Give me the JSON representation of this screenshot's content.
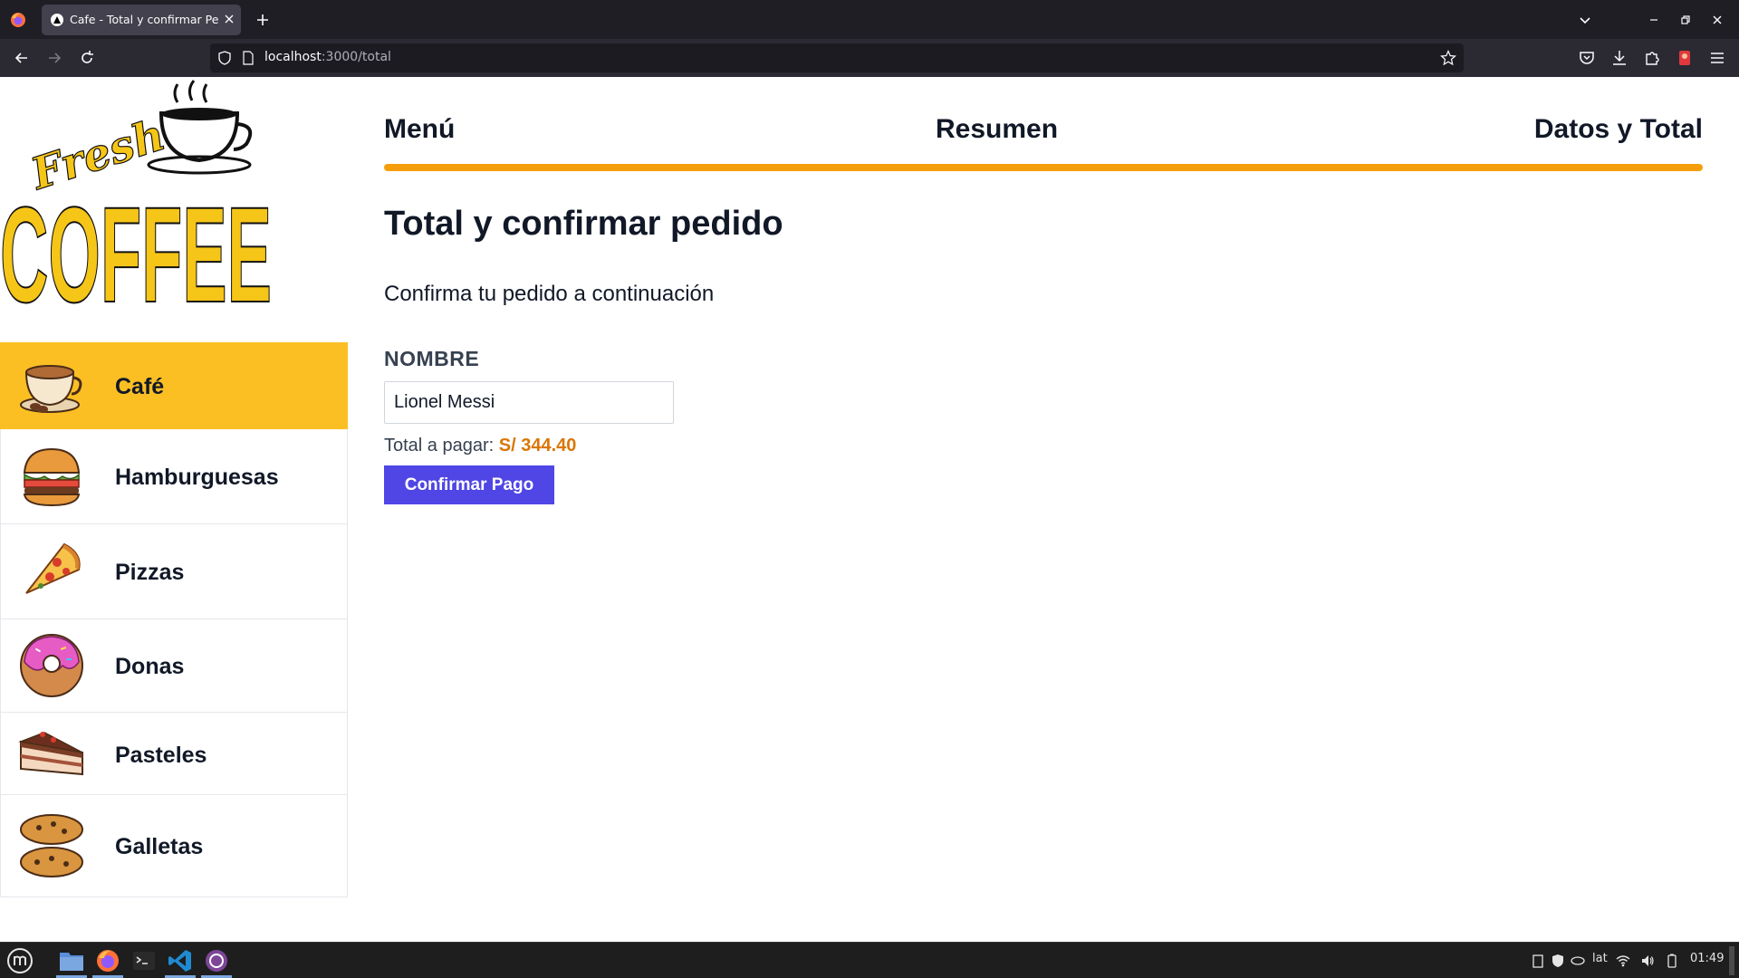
{
  "browser": {
    "tab_title": "Cafe - Total y confirmar Pedido",
    "url_host": "localhost",
    "url_path": ":3000/total"
  },
  "logo": {
    "script_word": "Fresh",
    "main_word": "COFFEE"
  },
  "sidebar": {
    "items": [
      {
        "label": "Café",
        "icon": "coffee-cup-icon",
        "active": true
      },
      {
        "label": "Hamburguesas",
        "icon": "burger-icon",
        "active": false
      },
      {
        "label": "Pizzas",
        "icon": "pizza-slice-icon",
        "active": false
      },
      {
        "label": "Donas",
        "icon": "donut-icon",
        "active": false
      },
      {
        "label": "Pasteles",
        "icon": "cake-slice-icon",
        "active": false
      },
      {
        "label": "Galletas",
        "icon": "cookies-icon",
        "active": false
      }
    ]
  },
  "steps": [
    {
      "label": "Menú"
    },
    {
      "label": "Resumen"
    },
    {
      "label": "Datos y Total"
    }
  ],
  "progress": 1.0,
  "main": {
    "title": "Total y confirmar pedido",
    "subtitle": "Confirma tu pedido a continuación",
    "name_label": "NOMBRE",
    "name_value": "Lionel Messi",
    "total_label": "Total a pagar:",
    "total_amount": "S/ 344.40",
    "confirm_button": "Confirmar Pago"
  },
  "taskbar": {
    "apps": [
      "mint-menu-icon",
      "files-icon",
      "firefox-icon",
      "terminal-icon",
      "vscode-icon",
      "tor-browser-icon"
    ],
    "keyboard_layout": "lat",
    "clock": "01:49"
  },
  "colors": {
    "accent_amber": "#fbbf24",
    "progress": "#f59e0b",
    "total_amount": "#d97706",
    "button": "#4f46e5"
  }
}
